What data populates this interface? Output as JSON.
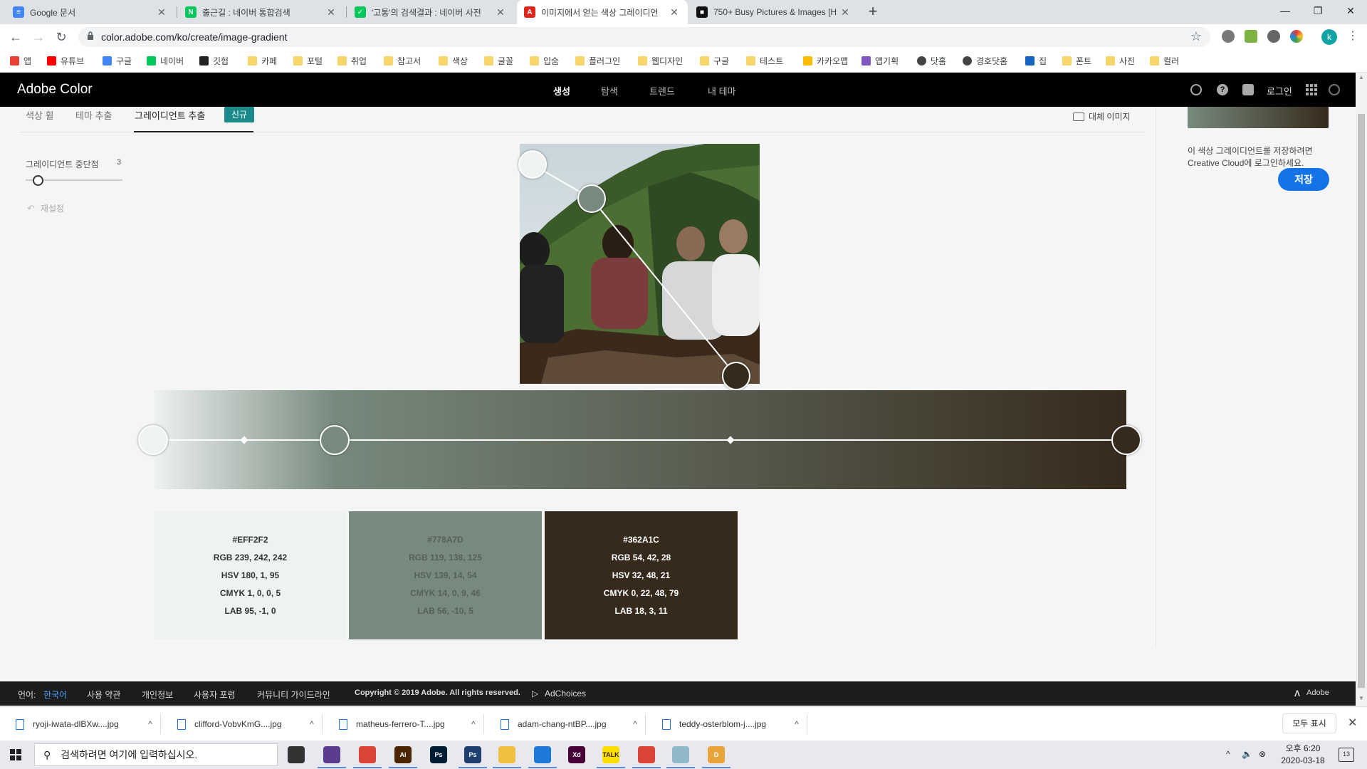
{
  "browser": {
    "tabs": [
      {
        "title": "Google 문서",
        "favicon_color": "#4285f4",
        "favicon_glyph": "≡"
      },
      {
        "title": "출근길 : 네이버 통합검색",
        "favicon_color": "#03c75a",
        "favicon_glyph": "N"
      },
      {
        "title": "'고통'의 검색결과 : 네이버 사전",
        "favicon_color": "#03c75a",
        "favicon_glyph": "✓"
      },
      {
        "title": "이미지에서 얻는 색상 그레이디언",
        "favicon_color": "#e1251b",
        "favicon_glyph": "A"
      },
      {
        "title": "750+ Busy Pictures & Images [H",
        "favicon_color": "#111111",
        "favicon_glyph": "■"
      }
    ],
    "url": "color.adobe.com/ko/create/image-gradient",
    "bookmarks": [
      {
        "label": "앱",
        "icon": "apps-grid-icon"
      },
      {
        "label": "유튜브",
        "icon": "youtube-icon"
      },
      {
        "label": "구글",
        "icon": "google-icon"
      },
      {
        "label": "네이버",
        "icon": "naver-icon"
      },
      {
        "label": "깃헙",
        "icon": "github-icon"
      },
      {
        "label": "카페",
        "icon": "folder-icon"
      },
      {
        "label": "포털",
        "icon": "folder-icon"
      },
      {
        "label": "취업",
        "icon": "folder-icon"
      },
      {
        "label": "참고서",
        "icon": "folder-icon"
      },
      {
        "label": "색상",
        "icon": "folder-icon"
      },
      {
        "label": "글꼴",
        "icon": "folder-icon"
      },
      {
        "label": "입숨",
        "icon": "folder-icon"
      },
      {
        "label": "플러그인",
        "icon": "folder-icon"
      },
      {
        "label": "웹디자인",
        "icon": "folder-icon"
      },
      {
        "label": "구글",
        "icon": "folder-icon"
      },
      {
        "label": "테스트",
        "icon": "folder-icon"
      },
      {
        "label": "카카오맵",
        "icon": "map-pin-icon"
      },
      {
        "label": "앱기획",
        "icon": "app-plan-icon"
      },
      {
        "label": "닷홈",
        "icon": "globe-icon"
      },
      {
        "label": "경호닷홈",
        "icon": "globe-icon"
      },
      {
        "label": "집",
        "icon": "home-icon"
      },
      {
        "label": "폰트",
        "icon": "folder-icon"
      },
      {
        "label": "사진",
        "icon": "folder-icon"
      },
      {
        "label": "컬러",
        "icon": "folder-icon"
      }
    ],
    "profile_initial": "k"
  },
  "adobe": {
    "brand": "Adobe Color",
    "nav": [
      "생성",
      "탐색",
      "트렌드",
      "내 테마"
    ],
    "login": "로그인",
    "subtabs": [
      "색상 휠",
      "테마 추출",
      "그레이디언트 추출"
    ],
    "new_badge": "신규",
    "alt_image": "대체 이미지",
    "stops_label": "그레이디언트 중단점",
    "stops_value": "3",
    "reset": "재설정",
    "save_message": "이 색상 그레이디언트를 저장하려면 Creative Cloud에 로그인하세요.",
    "save_button": "저장",
    "accent": "#1473e6",
    "badge_color": "#1a8a8a"
  },
  "gradient": {
    "stops": [
      {
        "hex": "#EFF2F2",
        "position_pct": 0
      },
      {
        "hex": "#778A7D",
        "position_pct": 18.6
      },
      {
        "hex": "#362A1C",
        "position_pct": 100
      }
    ]
  },
  "swatches": [
    {
      "hex": "#EFF2F2",
      "rgb": "RGB 239, 242, 242",
      "hsv": "HSV 180, 1, 95",
      "cmyk": "CMYK 1, 0, 0, 5",
      "lab": "LAB 95, -1, 0",
      "text_color": "#333333"
    },
    {
      "hex": "#778A7D",
      "rgb": "RGB 119, 138, 125",
      "hsv": "HSV 139, 14, 54",
      "cmyk": "CMYK 14, 0, 9, 46",
      "lab": "LAB 56, -10, 5",
      "text_color": "#55615a"
    },
    {
      "hex": "#362A1C",
      "rgb": "RGB 54, 42, 28",
      "hsv": "HSV 32, 48, 21",
      "cmyk": "CMYK 0, 22, 48, 79",
      "lab": "LAB 18, 3, 11",
      "text_color": "#ffffff"
    }
  ],
  "footer": {
    "lang_label": "언어:",
    "lang_value": "한국어",
    "links": [
      "사용 약관",
      "개인정보",
      "사용자 포럼",
      "커뮤니티 가이드라인"
    ],
    "copyright": "Copyright © 2019 Adobe. All rights reserved.",
    "adchoices": "AdChoices",
    "adobe": "Adobe"
  },
  "downloads": {
    "files": [
      "ryoji-iwata-dlBXw....jpg",
      "clifford-VobvKmG....jpg",
      "matheus-ferrero-T....jpg",
      "adam-chang-ntBP....jpg",
      "teddy-osterblom-j....jpg"
    ],
    "show_all": "모두 표시"
  },
  "taskbar": {
    "search_placeholder": "검색하려면 여기에 입력하십시오.",
    "apps": [
      {
        "name": "task-view-icon",
        "label": "",
        "color": "#333333"
      },
      {
        "name": "app-purple-icon",
        "label": "",
        "color": "#5b3d8f"
      },
      {
        "name": "chrome-icon",
        "label": "",
        "color": "#db4437"
      },
      {
        "name": "illustrator-icon",
        "label": "Ai",
        "color": "#4a2500"
      },
      {
        "name": "photoshop-icon",
        "label": "Ps",
        "color": "#001d34"
      },
      {
        "name": "photoshop-2-icon",
        "label": "Ps",
        "color": "#1f3f6e"
      },
      {
        "name": "file-explorer-icon",
        "label": "",
        "color": "#f0c040"
      },
      {
        "name": "vscode-icon",
        "label": "",
        "color": "#1e7ad8"
      },
      {
        "name": "xd-icon",
        "label": "Xd",
        "color": "#470137"
      },
      {
        "name": "kakaotalk-icon",
        "label": "TALK",
        "color": "#f9e000"
      },
      {
        "name": "chrome-2-icon",
        "label": "",
        "color": "#db4437"
      },
      {
        "name": "app-cyan-icon",
        "label": "",
        "color": "#8fb8c8"
      },
      {
        "name": "dreamweaver-icon",
        "label": "D",
        "color": "#e8a33a"
      }
    ],
    "time": "오후 6:20",
    "date": "2020-03-18",
    "notifications": "13"
  }
}
